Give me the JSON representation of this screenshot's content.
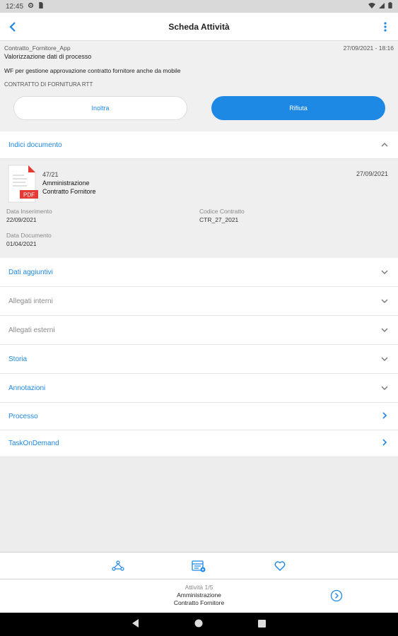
{
  "status": {
    "time": "12:45"
  },
  "appbar": {
    "title": "Scheda Attività"
  },
  "header": {
    "app_name": "Contratto_Fornitore_App",
    "datetime": "27/09/2021 - 18:16",
    "process_step": "Valorizzazione dati di processo",
    "description": "WF per gestione approvazione contratto fornitore anche da mobile",
    "contract": "CONTRATTO DI FORNITURA RTT"
  },
  "actions": {
    "inoltra": "Inoltra",
    "rifiuta": "Rifiuta"
  },
  "sections": {
    "indici": "Indici documento",
    "dati_aggiuntivi": "Dati aggiuntivi",
    "allegati_interni": "Allegati interni",
    "allegati_esterni": "Allegati esterni",
    "storia": "Storia",
    "annotazioni": "Annotazioni",
    "processo": "Processo",
    "taskondemand": "TaskOnDemand"
  },
  "document": {
    "badge": "PDF",
    "number": "47/21",
    "area": "Amministrazione",
    "name": "Contratto Fornitore",
    "date": "27/09/2021",
    "fields": {
      "data_inserimento_label": "Data Inserimento",
      "data_inserimento_value": "22/09/2021",
      "codice_contratto_label": "Codice Contratto",
      "codice_contratto_value": "CTR_27_2021",
      "data_documento_label": "Data Documento",
      "data_documento_value": "01/04/2021"
    }
  },
  "activity": {
    "counter": "Attività 1/5",
    "area": "Amministrazione",
    "name": "Contratto Fornitore"
  },
  "colors": {
    "accent": "#1e88e5",
    "pdf_red": "#e53935"
  }
}
